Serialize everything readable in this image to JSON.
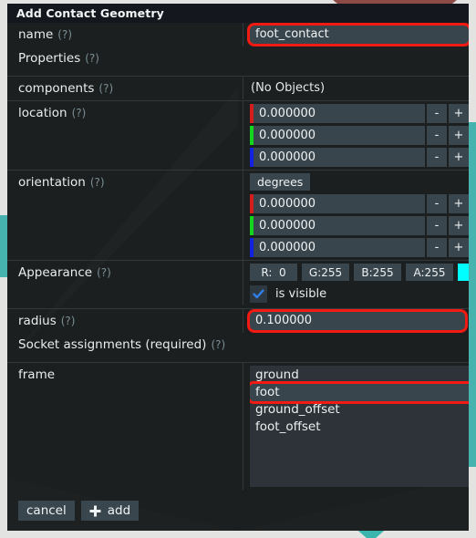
{
  "window": {
    "title": "Add Contact Geometry"
  },
  "colors": {
    "accent_red": "#f21a12",
    "swatch": "#00ffff",
    "axis_x": "#d61d1d",
    "axis_y": "#14d61d",
    "axis_z": "#1322e0",
    "panel": "#1c1f1f",
    "titlebar": "#14171d",
    "field": "#39454c",
    "check": "#2f80ed"
  },
  "help_marker": "(?)",
  "fields": {
    "name": {
      "label": "name",
      "value": "foot_contact",
      "placeholder": "name"
    },
    "properties": {
      "label": "Properties"
    },
    "components": {
      "label": "components",
      "value": "(No Objects)"
    },
    "location": {
      "label": "location",
      "axes": [
        {
          "axis": "x",
          "value": "0.000000"
        },
        {
          "axis": "y",
          "value": "0.000000"
        },
        {
          "axis": "z",
          "value": "0.000000"
        }
      ]
    },
    "orientation": {
      "label": "orientation",
      "unit_button": "degrees",
      "axes": [
        {
          "axis": "x",
          "value": "0.000000"
        },
        {
          "axis": "y",
          "value": "0.000000"
        },
        {
          "axis": "z",
          "value": "0.000000"
        }
      ]
    },
    "appearance": {
      "label": "Appearance",
      "channels": [
        {
          "name": "R",
          "text": "R:  0"
        },
        {
          "name": "G",
          "text": "G:255"
        },
        {
          "name": "B",
          "text": "B:255"
        },
        {
          "name": "A",
          "text": "A:255"
        }
      ],
      "swatch_color": "#00ffff",
      "is_visible_label": "is visible",
      "is_visible_checked": true
    },
    "radius": {
      "label": "radius",
      "value": "0.100000"
    },
    "socket_assignments": {
      "label": "Socket assignments (required)"
    },
    "frame": {
      "label": "frame",
      "options": [
        "ground",
        "foot",
        "ground_offset",
        "foot_offset"
      ],
      "selected": "foot",
      "selected_index": 1
    }
  },
  "stepper": {
    "decrement": "-",
    "increment": "+"
  },
  "footer": {
    "cancel_label": "cancel",
    "add_label": "add",
    "add_icon": "plus-icon"
  }
}
